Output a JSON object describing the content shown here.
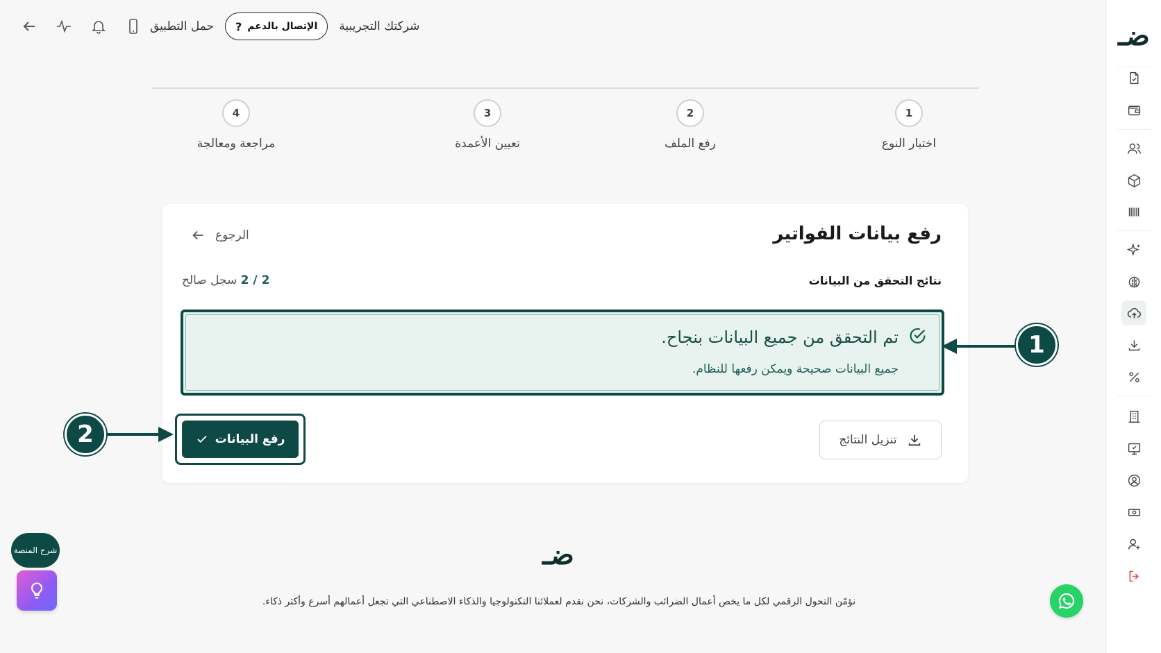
{
  "topbar": {
    "company": "شركتك التجريبية",
    "support_label": "الإتصال بالدعم",
    "download_app": "حمل التطبيق"
  },
  "stepper": {
    "steps": [
      {
        "number": "1",
        "label": "اختيار النوع"
      },
      {
        "number": "2",
        "label": "رفع الملف"
      },
      {
        "number": "3",
        "label": "تعيين الأعمدة"
      },
      {
        "number": "4",
        "label": "مراجعة ومعالجة"
      }
    ]
  },
  "card": {
    "title": "رفع بيانات الفواتير",
    "back_label": "الرجوع",
    "results_label": "نتائج التحقق من البيانات",
    "count_value": "2 / 2",
    "count_suffix": "سجل صالح",
    "success_title": "تم التحقق من جميع البيانات بنجاح.",
    "success_sub": "جميع البيانات صحيحة ويمكن رفعها للنظام.",
    "download_label": "تنزيل النتائج",
    "upload_label": "رفع البيانات"
  },
  "annotations": {
    "first": "1",
    "second": "2"
  },
  "footer": {
    "logo": "ضـ",
    "text": "نؤمّن التحول الرقمي لكل ما يخص أعمال الضرائب والشركات، نحن نقدم لعملائنا التكنولوجيا والذكاء الاصطناعي التي تجعل أعمالهم أسرع وأكثر ذكاء."
  },
  "widgets": {
    "explain_label": "شرح المنصة"
  },
  "sidebar": {
    "logo": "ضـ"
  },
  "colors": {
    "brand": "#0e4a45",
    "success_bg": "#e8f3ef",
    "logout": "#e0453c"
  }
}
